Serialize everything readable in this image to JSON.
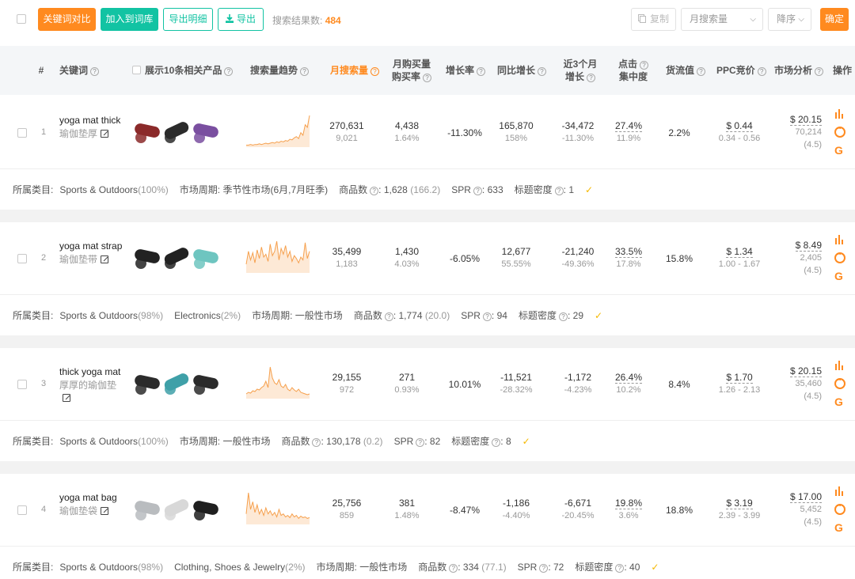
{
  "toolbar": {
    "btn_compare": "关键词对比",
    "btn_add_lib": "加入到词库",
    "btn_export_detail": "导出明细",
    "btn_export": "导出",
    "result_label": "搜索结果数:",
    "result_count": "484",
    "btn_copy": "复制",
    "sort_field": "月搜索量",
    "sort_order": "降序",
    "btn_confirm": "确定"
  },
  "header": {
    "index": "#",
    "keyword": "关键词",
    "products": "展示10条相关产品",
    "trend": "搜索量趋势",
    "monthly_search": "月搜索量",
    "monthly_buy_1": "月购买量",
    "monthly_buy_2": "购买率",
    "growth": "增长率",
    "yoy": "同比增长",
    "recent3_1": "近3个月",
    "recent3_2": "增长",
    "click_1": "点击",
    "click_2": "集中度",
    "flow": "货流值",
    "ppc": "PPC竞价",
    "market": "市场分析",
    "ops": "操作"
  },
  "labels": {
    "category": "所属类目:",
    "cycle": "市场周期:",
    "product_count": "商品数",
    "spr": "SPR",
    "title_density": "标题密度"
  },
  "rows": [
    {
      "index": "1",
      "keyword": "yoga mat thick",
      "keyword_cn": "瑜伽垫厚",
      "search": "270,631",
      "search_sub": "9,021",
      "buy": "4,438",
      "buy_rate": "1.64%",
      "growth": "-11.30%",
      "yoy": "165,870",
      "yoy_sub": "158%",
      "recent": "-34,472",
      "recent_sub": "-11.30%",
      "click": "27.4%",
      "click_sub": "11.9%",
      "flow": "2.2%",
      "ppc": "$ 0.44",
      "ppc_range": "0.34 - 0.56",
      "market_price": "$ 20.15",
      "market_reviews": "70,214",
      "market_rating": "(4.5)",
      "categories": [
        {
          "name": "Sports & Outdoors",
          "pct": "(100%)"
        }
      ],
      "cycle": "季节性市场",
      "cycle_note": "(6月,7月旺季)",
      "product_count": "1,628",
      "product_ratio": "(166.2)",
      "spr": "633",
      "title_density": "1",
      "thumb_colors": [
        "#8b2a2a",
        "#2b2b2b",
        "#7a4fa0"
      ],
      "trend": [
        3,
        3,
        4,
        3,
        4,
        4,
        5,
        4,
        5,
        6,
        5,
        6,
        7,
        6,
        8,
        7,
        9,
        8,
        10,
        9,
        12,
        11,
        14,
        16,
        13,
        22,
        18,
        34,
        30,
        48
      ]
    },
    {
      "index": "2",
      "keyword": "yoga mat strap",
      "keyword_cn": "瑜伽垫带",
      "search": "35,499",
      "search_sub": "1,183",
      "buy": "1,430",
      "buy_rate": "4.03%",
      "growth": "-6.05%",
      "yoy": "12,677",
      "yoy_sub": "55.55%",
      "recent": "-21,240",
      "recent_sub": "-49.36%",
      "click": "33.5%",
      "click_sub": "17.8%",
      "flow": "15.8%",
      "ppc": "$ 1.34",
      "ppc_range": "1.00 - 1.67",
      "market_price": "$ 8.49",
      "market_reviews": "2,405",
      "market_rating": "(4.5)",
      "categories": [
        {
          "name": "Sports & Outdoors",
          "pct": "(98%)"
        },
        {
          "name": "Electronics",
          "pct": "(2%)"
        }
      ],
      "cycle": "一般性市场",
      "cycle_note": "",
      "product_count": "1,774",
      "product_ratio": "(20.0)",
      "spr": "94",
      "title_density": "29",
      "thumb_colors": [
        "#222222",
        "#222222",
        "#6ec5c0"
      ],
      "trend": [
        12,
        30,
        18,
        28,
        14,
        32,
        20,
        36,
        22,
        26,
        16,
        40,
        24,
        30,
        44,
        18,
        34,
        26,
        38,
        22,
        30,
        16,
        24,
        20,
        14,
        22,
        18,
        42,
        20,
        30
      ]
    },
    {
      "index": "3",
      "keyword": "thick yoga mat",
      "keyword_cn": "厚厚的瑜伽垫",
      "search": "29,155",
      "search_sub": "972",
      "buy": "271",
      "buy_rate": "0.93%",
      "growth": "10.01%",
      "yoy": "-11,521",
      "yoy_sub": "-28.32%",
      "recent": "-1,172",
      "recent_sub": "-4.23%",
      "click": "26.4%",
      "click_sub": "10.2%",
      "flow": "8.4%",
      "ppc": "$ 1.70",
      "ppc_range": "1.26 - 2.13",
      "market_price": "$ 20.15",
      "market_reviews": "35,460",
      "market_rating": "(4.5)",
      "categories": [
        {
          "name": "Sports & Outdoors",
          "pct": "(100%)"
        }
      ],
      "cycle": "一般性市场",
      "cycle_note": "",
      "product_count": "130,178",
      "product_ratio": "(0.2)",
      "spr": "82",
      "title_density": "8",
      "thumb_colors": [
        "#2b2b2b",
        "#3fa0a8",
        "#2b2b2b"
      ],
      "trend": [
        6,
        8,
        7,
        10,
        9,
        12,
        11,
        14,
        16,
        22,
        14,
        40,
        26,
        20,
        18,
        24,
        16,
        14,
        18,
        12,
        10,
        14,
        11,
        9,
        12,
        8,
        7,
        6,
        5,
        6
      ]
    },
    {
      "index": "4",
      "keyword": "yoga mat bag",
      "keyword_cn": "瑜伽垫袋",
      "search": "25,756",
      "search_sub": "859",
      "buy": "381",
      "buy_rate": "1.48%",
      "growth": "-8.47%",
      "yoy": "-1,186",
      "yoy_sub": "-4.40%",
      "recent": "-6,671",
      "recent_sub": "-20.45%",
      "click": "19.8%",
      "click_sub": "3.6%",
      "flow": "18.8%",
      "ppc": "$ 3.19",
      "ppc_range": "2.39 - 3.99",
      "market_price": "$ 17.00",
      "market_reviews": "5,452",
      "market_rating": "(4.5)",
      "categories": [
        {
          "name": "Sports & Outdoors",
          "pct": "(98%)"
        },
        {
          "name": "Clothing, Shoes & Jewelry",
          "pct": "(2%)"
        }
      ],
      "cycle": "一般性市场",
      "cycle_note": "",
      "product_count": "334",
      "product_ratio": "(77.1)",
      "spr": "72",
      "title_density": "40",
      "thumb_colors": [
        "#b9bcbf",
        "#d8d8d8",
        "#1f1f1f"
      ],
      "trend": [
        14,
        42,
        20,
        30,
        16,
        26,
        14,
        20,
        12,
        22,
        14,
        18,
        12,
        16,
        10,
        20,
        12,
        14,
        10,
        12,
        9,
        14,
        10,
        12,
        8,
        11,
        9,
        10,
        8,
        9
      ]
    }
  ]
}
